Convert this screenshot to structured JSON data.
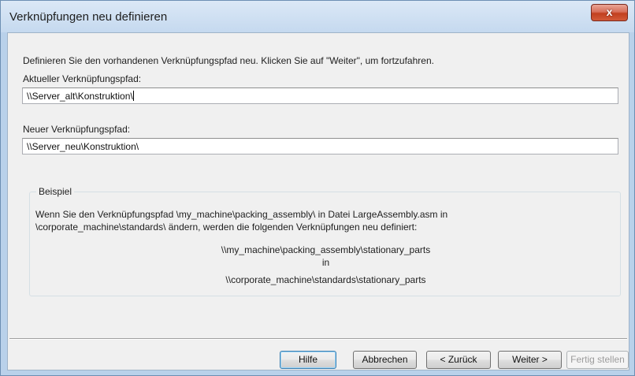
{
  "window": {
    "title": "Verknüpfungen neu definieren",
    "close_label": "x"
  },
  "instruction": "Definieren Sie den vorhandenen Verknüpfungspfad neu. Klicken Sie auf \"Weiter\", um fortzufahren.",
  "current_path": {
    "label": "Aktueller Verknüpfungspfad:",
    "value": "\\\\Server_alt\\Konstruktion\\"
  },
  "new_path": {
    "label": "Neuer Verknüpfungspfad:",
    "value": "\\\\Server_neu\\Konstruktion\\"
  },
  "example": {
    "title": "Beispiel",
    "line1": "Wenn Sie den Verknüpfungspfad \\my_machine\\packing_assembly\\ in Datei LargeAssembly.asm in",
    "line2": "\\corporate_machine\\standards\\ ändern, werden die folgenden Verknüpfungen neu definiert:",
    "from_path": "\\\\my_machine\\packing_assembly\\stationary_parts",
    "connector": "in",
    "to_path": "\\\\corporate_machine\\standards\\stationary_parts"
  },
  "buttons": {
    "help": "Hilfe",
    "cancel": "Abbrechen",
    "back": "< Zurück",
    "next": "Weiter >",
    "finish": "Fertig stellen"
  }
}
